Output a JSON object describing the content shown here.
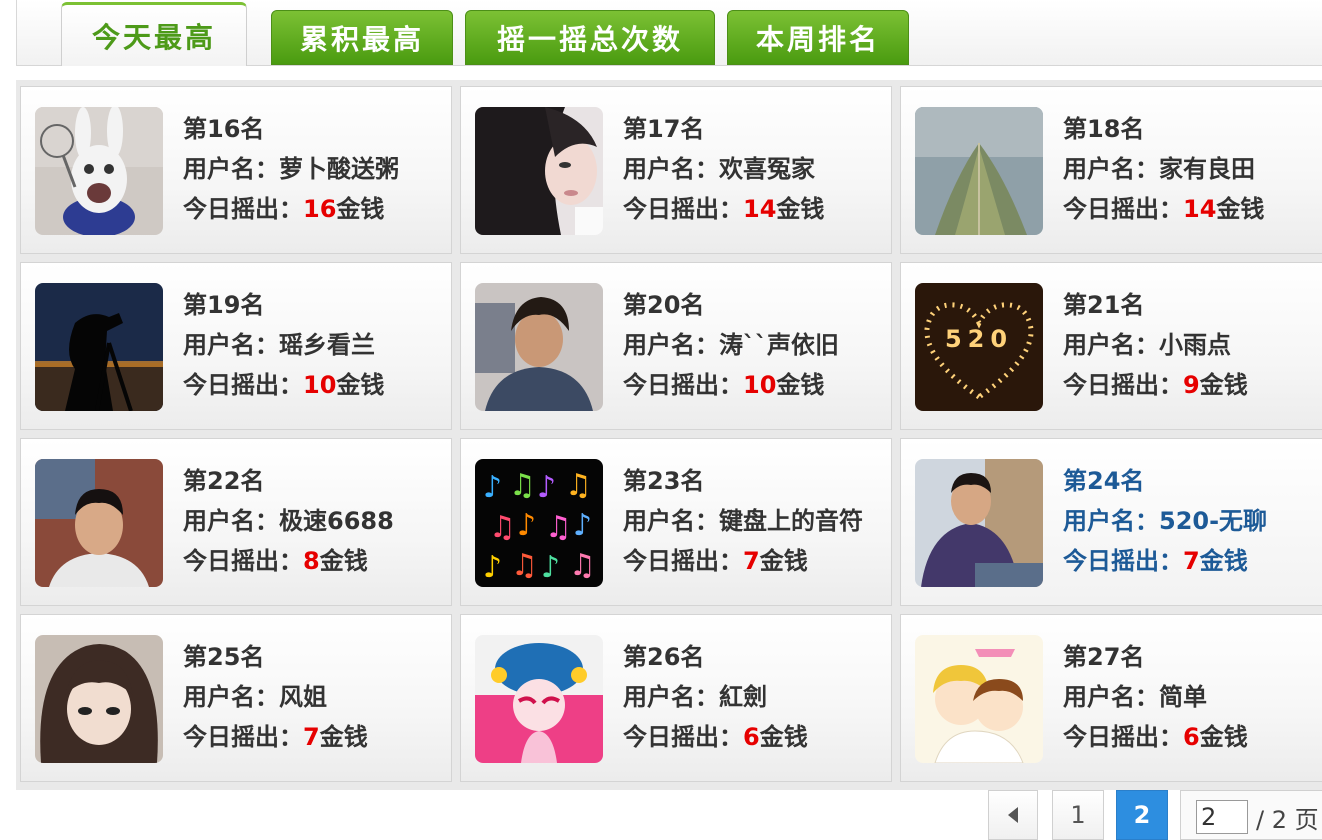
{
  "tabs": [
    {
      "label": "今天最高",
      "active": true
    },
    {
      "label": "累积最高",
      "active": false
    },
    {
      "label": "摇一摇总次数",
      "active": false
    },
    {
      "label": "本周排名",
      "active": false
    }
  ],
  "entries": [
    {
      "rank": "第16名",
      "user_label": "用户名：",
      "username": "萝卜酸送粥",
      "earn_label": "今日摇出：",
      "amount": "16",
      "unit": "金钱",
      "avatar": "rabbit-avatar-image"
    },
    {
      "rank": "第17名",
      "user_label": "用户名：",
      "username": "欢喜冤家",
      "earn_label": "今日摇出：",
      "amount": "14",
      "unit": "金钱",
      "avatar": "girl-avatar-image"
    },
    {
      "rank": "第18名",
      "user_label": "用户名：",
      "username": "家有良田",
      "earn_label": "今日摇出：",
      "amount": "14",
      "unit": "金钱",
      "avatar": "pier-avatar-image"
    },
    {
      "rank": "第19名",
      "user_label": "用户名：",
      "username": "瑶乡看兰",
      "earn_label": "今日摇出：",
      "amount": "10",
      "unit": "金钱",
      "avatar": "photographer-silhouette-avatar-image"
    },
    {
      "rank": "第20名",
      "user_label": "用户名：",
      "username": "涛``声依旧",
      "earn_label": "今日摇出：",
      "amount": "10",
      "unit": "金钱",
      "avatar": "young-man-avatar-image"
    },
    {
      "rank": "第21名",
      "user_label": "用户名：",
      "username": "小雨点",
      "earn_label": "今日摇出：",
      "amount": "9",
      "unit": "金钱",
      "avatar": "candle-heart-520-avatar-image"
    },
    {
      "rank": "第22名",
      "user_label": "用户名：",
      "username": "极速6688",
      "earn_label": "今日摇出：",
      "amount": "8",
      "unit": "金钱",
      "avatar": "man-portrait-avatar-image"
    },
    {
      "rank": "第23名",
      "user_label": "用户名：",
      "username": "键盘上的音符",
      "earn_label": "今日摇出：",
      "amount": "7",
      "unit": "金钱",
      "avatar": "music-notes-avatar-image"
    },
    {
      "rank": "第24名",
      "user_label": "用户名：",
      "username": "520-无聊",
      "earn_label": "今日摇出：",
      "amount": "7",
      "unit": "金钱",
      "avatar": "man-sitting-avatar-image"
    },
    {
      "rank": "第25名",
      "user_label": "用户名：",
      "username": "风姐",
      "earn_label": "今日摇出：",
      "amount": "7",
      "unit": "金钱",
      "avatar": "anime-girl-avatar-image"
    },
    {
      "rank": "第26名",
      "user_label": "用户名：",
      "username": "紅劍",
      "earn_label": "今日摇出：",
      "amount": "6",
      "unit": "金钱",
      "avatar": "opera-cartoon-avatar-image"
    },
    {
      "rank": "第27名",
      "user_label": "用户名：",
      "username": "简单",
      "earn_label": "今日摇出：",
      "amount": "6",
      "unit": "金钱",
      "avatar": "cartoon-couple-avatar-image"
    }
  ],
  "pagination": {
    "prev_icon": "chevron-left-icon",
    "pages": [
      "1",
      "2"
    ],
    "current": "2",
    "input_value": "2",
    "total_label": "/ 2 页"
  },
  "colors": {
    "tab_green": "#5aa81a",
    "amount_red": "#e60000",
    "highlight_blue": "#1d5a97",
    "page_active": "#2d8ee0"
  }
}
